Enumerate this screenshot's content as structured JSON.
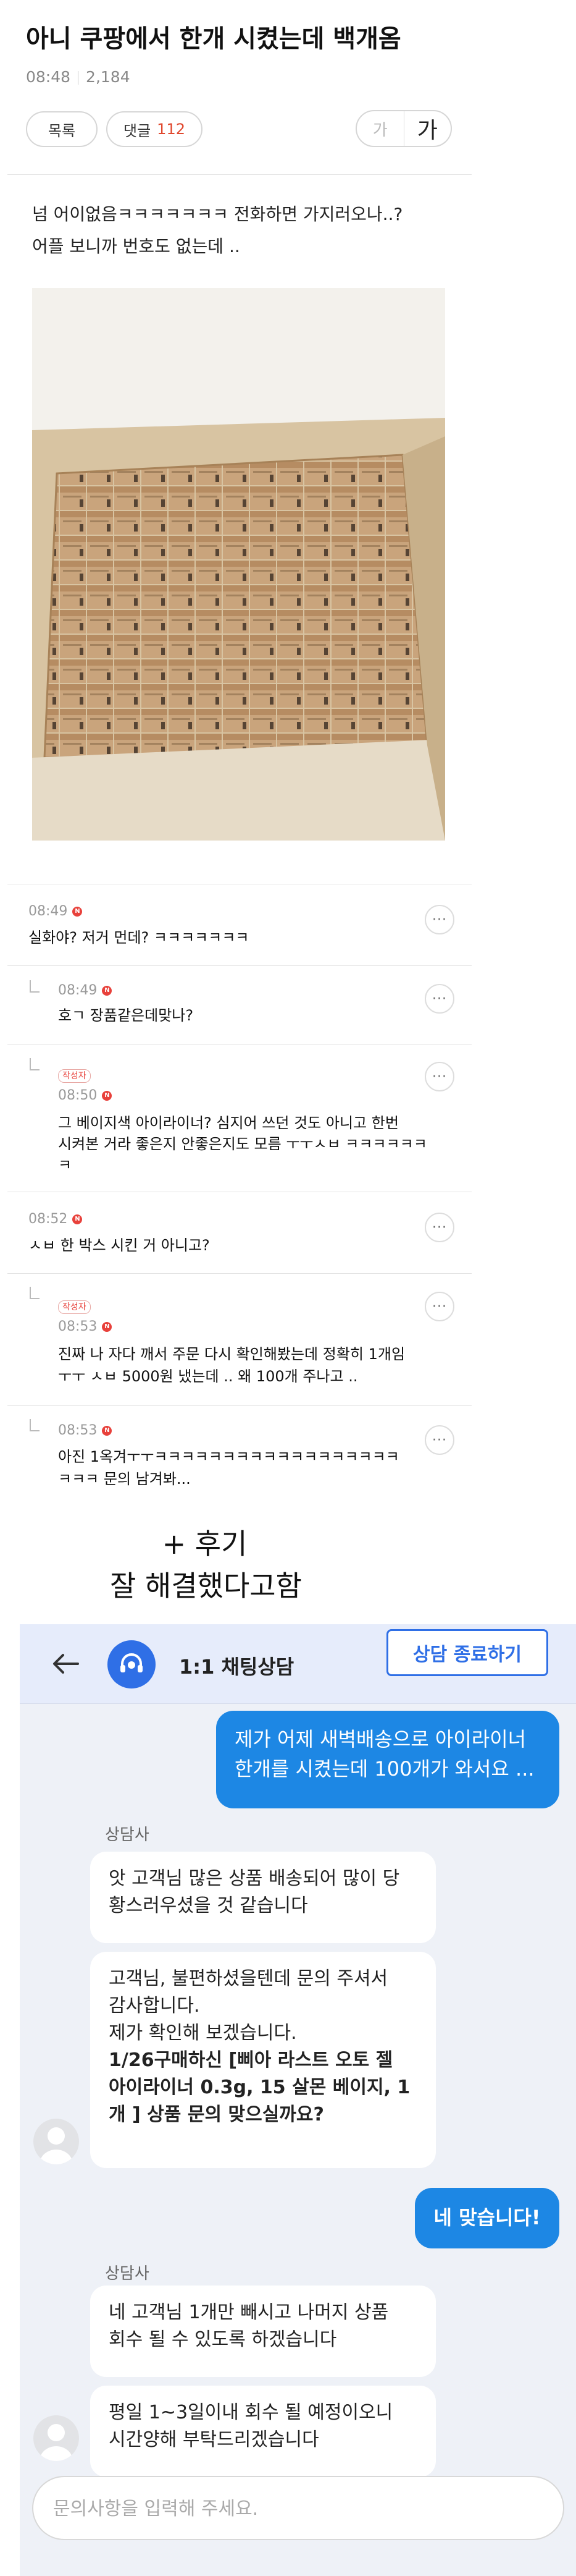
{
  "post": {
    "title": "아니 쿠팡에서 한개 시켰는데 백개옴",
    "time": "08:48",
    "views": "2,184",
    "list_label": "목록",
    "comments_label": "댓글",
    "comments_count": "112",
    "font_small": "가",
    "font_large": "가",
    "body_line1": "넘 어이없음ㅋㅋㅋㅋㅋㅋㅋ 전화하면 가지러오나..?",
    "body_line2": "어플 보니까 번호도 없는데 .."
  },
  "comments": [
    {
      "time": "08:49",
      "badge": "N",
      "text": "실화야? 저거 먼데? ㅋㅋㅋㅋㅋㅋㅋ",
      "more": "···"
    },
    {
      "time": "08:49",
      "badge": "N",
      "text": "호ㄱ 장품같은데맞나?",
      "more": "···"
    },
    {
      "author": "작성자",
      "time": "08:50",
      "badge": "N",
      "text1": "그 베이지색 아이라이너? 심지어 쓰던 것도 아니고 한번",
      "text2": "시켜본 거라 좋은지 안좋은지도 모름 ㅜㅜㅅㅂ ㅋㅋㅋㅋㅋㅋ",
      "text3": "ㅋ",
      "more": "···"
    },
    {
      "time": "08:52",
      "badge": "N",
      "text": "ㅅㅂ 한 박스 시킨 거 아니고?",
      "more": "···"
    },
    {
      "author": "작성자",
      "time": "08:53",
      "badge": "N",
      "text1": "진짜 나 자다 깨서 주문 다시 확인해봤는데 정확히 1개임",
      "text2": "ㅜㅜ ㅅㅂ 5000원 냈는데 .. 왜 100개 주나고 ..",
      "more": "···"
    },
    {
      "time": "08:53",
      "badge": "N",
      "text1": "아진 1옥겨ㅜㅜㅋㅋㅋㅋㅋㅋㅋㅋㅋㅋㅋㅋㅋㅋㅋㅋㅋㅋ",
      "text2": "ㅋㅋㅋ 문의 남겨봐...",
      "more": "···"
    }
  ],
  "after": {
    "line1": "+ 후기",
    "line2": "잘 해결했다고함"
  },
  "chat": {
    "title": "1:1 채팅상담",
    "end_button": "상담 종료하기",
    "back_icon": "arrow-left",
    "msg_me1_line1": "제가 어제 새벽배송으로 아이라이너",
    "msg_me1_line2": "한개를 시켰는데 100개가 와서요 ...",
    "agent_name1": "상담사",
    "msg_a1_line1": "앗 고객님 많은 상품 배송되어 많이 당",
    "msg_a1_line2": "황스러우셨을 것 같습니다",
    "msg_a2_line1": "고객님, 불편하셨을텐데 문의 주셔서",
    "msg_a2_line2": "감사합니다.",
    "msg_a2_line3": "제가 확인해 보겠습니다.",
    "msg_a2_line4": "1/26구매하신 [삐아 라스트 오토 젤",
    "msg_a2_line5": "아이라이너 0.3g, 15 살몬 베이지, 1",
    "msg_a2_line6": "개 ] 상품 문의 맞으실까요?",
    "msg_me2": "네 맞습니다!",
    "agent_name2": "상담사",
    "msg_a3_line1": "네 고객님 1개만 빼시고 나머지 상품",
    "msg_a3_line2": "회수 될 수 있도록 하겠습니다",
    "msg_a4_line1": "평일 1~3일이내 회수 될 예정이오니",
    "msg_a4_line2": "시간양해 부탁드리겠습니다",
    "input_placeholder": "문의사항을 입력해 주세요."
  }
}
